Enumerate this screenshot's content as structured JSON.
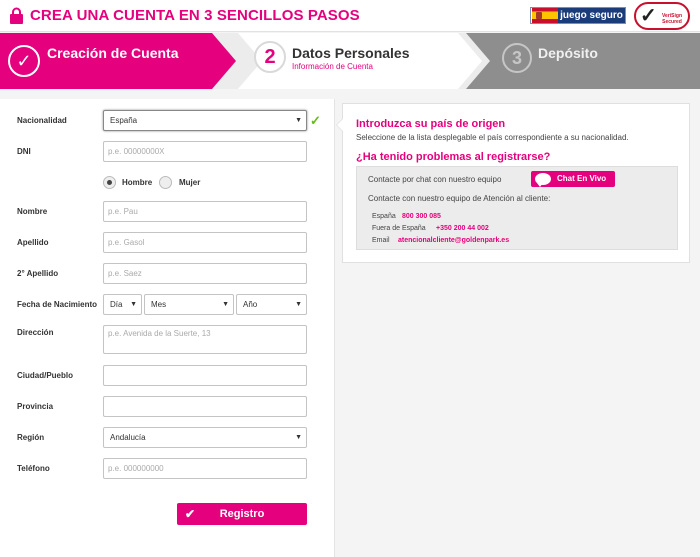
{
  "header": {
    "title": "CREA UNA CUENTA EN 3 SENCILLOS PASOS",
    "badge": "juego seguro",
    "verisign": "VeriSign Secured"
  },
  "steps": [
    {
      "label": "Creación de Cuenta"
    },
    {
      "number": "2",
      "label": "Datos Personales",
      "sub": "Información de Cuenta"
    },
    {
      "number": "3",
      "label": "Depósito"
    }
  ],
  "form": {
    "nacionalidad": {
      "label": "Nacionalidad",
      "value": "España"
    },
    "dni": {
      "label": "DNI",
      "placeholder": "p.e. 00000000X"
    },
    "genero": {
      "hombre": "Hombre",
      "mujer": "Mujer"
    },
    "nombre": {
      "label": "Nombre",
      "placeholder": "p.e. Pau"
    },
    "apellido": {
      "label": "Apellido",
      "placeholder": "p.e. Gasol"
    },
    "apellido2": {
      "label": "2° Apellido",
      "placeholder": "p.e. Saez"
    },
    "fecha": {
      "label": "Fecha de Nacimiento",
      "dia": "Día",
      "mes": "Mes",
      "anio": "Año"
    },
    "direccion": {
      "label": "Dirección",
      "placeholder": "p.e. Avenida de la Suerte, 13"
    },
    "ciudad": {
      "label": "Ciudad/Pueblo"
    },
    "provincia": {
      "label": "Provincia"
    },
    "region": {
      "label": "Región",
      "value": "Andalucía"
    },
    "telefono": {
      "label": "Teléfono",
      "placeholder": "p.e. 000000000"
    },
    "submit": "Registro"
  },
  "info": {
    "title": "Introduzca su país de origen",
    "sub": "Seleccione de la lista desplegable el país correspondiente a su nacionalidad.",
    "q": "¿Ha tenido problemas al registrarse?",
    "chat_text": "Contacte por chat con nuestro equipo",
    "chat_btn": "Chat En Vivo",
    "contact_text": "Contacte con nuestro equipo de Atención al cliente:",
    "rows": [
      {
        "label": "España",
        "value": "800 300 085"
      },
      {
        "label": "Fuera de España",
        "value": "+350 200 44 002"
      },
      {
        "label": "Email",
        "value": "atencionalcliente@goldenpark.es"
      }
    ]
  },
  "colors": {
    "accent": "#e5007e",
    "ok": "#66bb1a"
  }
}
